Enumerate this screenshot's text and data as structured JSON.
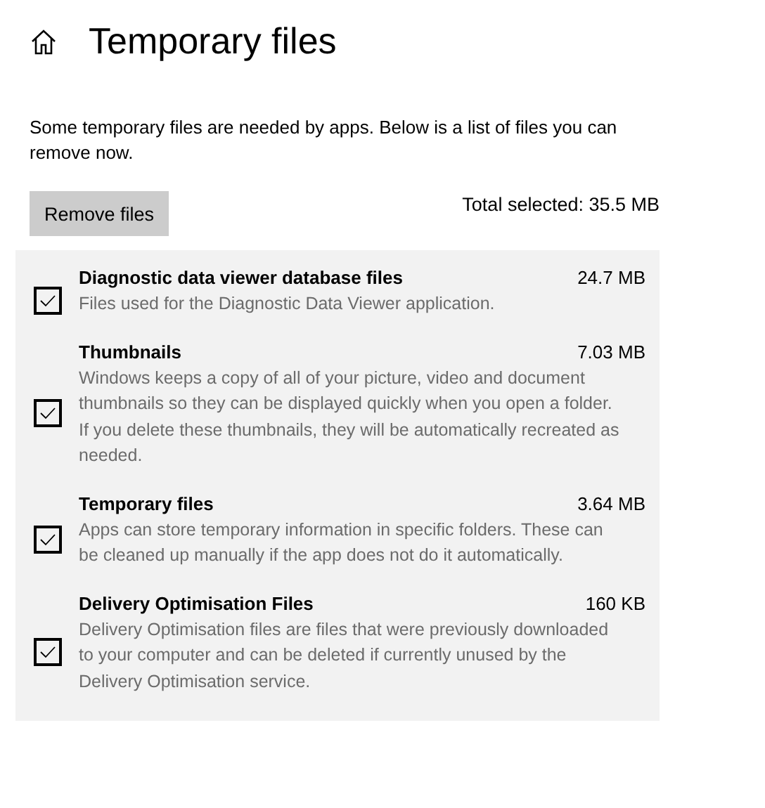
{
  "page": {
    "title": "Temporary files",
    "description": "Some temporary files are needed by apps. Below is a list of files you can remove now."
  },
  "remove_button": "Remove files",
  "total_selected": "Total selected: 35.5 MB",
  "files": [
    {
      "name": "Diagnostic data viewer database files",
      "size": "24.7 MB",
      "description": "Files used for the Diagnostic Data Viewer application.",
      "checked": true
    },
    {
      "name": "Thumbnails",
      "size": "7.03 MB",
      "description": "Windows keeps a copy of all of your picture, video and document thumbnails so they can be displayed quickly when you open a folder. If you delete these thumbnails, they will be automatically recreated as needed.",
      "checked": true
    },
    {
      "name": "Temporary files",
      "size": "3.64 MB",
      "description": "Apps can store temporary information in specific folders. These can be cleaned up manually if the app does not do it automatically.",
      "checked": true
    },
    {
      "name": "Delivery Optimisation Files",
      "size": "160 KB",
      "description": "Delivery Optimisation files are files that were previously downloaded to your computer and can be deleted if currently unused by the Delivery Optimisation service.",
      "checked": true
    }
  ]
}
